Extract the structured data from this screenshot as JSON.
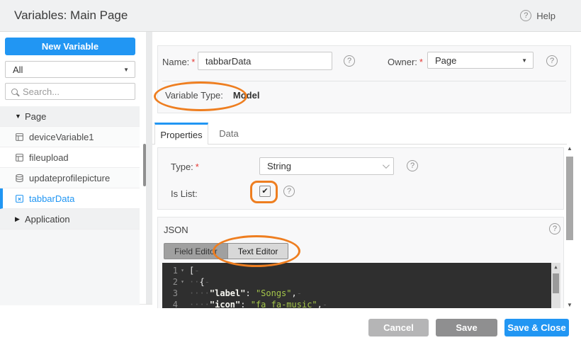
{
  "header": {
    "title": "Variables: Main Page",
    "help_label": "Help"
  },
  "icons": {
    "help_glyph": "?",
    "check_glyph": "✔",
    "caret_down": "▼",
    "caret_right": "▶",
    "select_caret": "▼",
    "fold_glyph": "▾",
    "arrow_up": "▲",
    "arrow_down": "▼"
  },
  "sidebar": {
    "new_variable_label": "New Variable",
    "filter": {
      "value": "All"
    },
    "search": {
      "placeholder": "Search..."
    },
    "tree": [
      {
        "type": "group",
        "label": "Page",
        "expanded": true
      },
      {
        "type": "item",
        "label": "deviceVariable1",
        "icon": "device-variable-icon",
        "selected": false
      },
      {
        "type": "item",
        "label": "fileupload",
        "icon": "device-variable-icon",
        "selected": false
      },
      {
        "type": "item",
        "label": "updateprofilepicture",
        "icon": "service-variable-icon",
        "selected": false
      },
      {
        "type": "item",
        "label": "tabbarData",
        "icon": "model-variable-icon",
        "selected": true
      },
      {
        "type": "group",
        "label": "Application",
        "expanded": false
      }
    ]
  },
  "form": {
    "name": {
      "label": "Name:",
      "required_mark": "*",
      "value": "tabbarData"
    },
    "owner": {
      "label": "Owner:",
      "required_mark": "*",
      "value": "Page"
    },
    "variable_type": {
      "label": "Variable Type:",
      "value": "Model"
    }
  },
  "tabs": {
    "items": [
      {
        "label": "Properties",
        "active": true
      },
      {
        "label": "Data",
        "active": false
      }
    ]
  },
  "properties": {
    "type": {
      "label": "Type:",
      "required_mark": "*",
      "value": "String"
    },
    "is_list": {
      "label": "Is List:",
      "checked": true
    }
  },
  "json_section": {
    "title": "JSON",
    "modes": [
      {
        "label": "Field Editor",
        "active": false
      },
      {
        "label": "Text Editor",
        "active": true
      }
    ],
    "code_lines": [
      {
        "num": "1",
        "fold": true,
        "tokens": [
          {
            "c": "punct",
            "t": "["
          }
        ]
      },
      {
        "num": "2",
        "fold": true,
        "tokens": [
          {
            "c": "ws",
            "t": "  "
          },
          {
            "c": "punct",
            "t": "{"
          }
        ]
      },
      {
        "num": "3",
        "fold": false,
        "tokens": [
          {
            "c": "ws",
            "t": "    "
          },
          {
            "c": "key",
            "t": "\"label\""
          },
          {
            "c": "punct",
            "t": ": "
          },
          {
            "c": "str",
            "t": "\"Songs\""
          },
          {
            "c": "punct",
            "t": ","
          }
        ]
      },
      {
        "num": "4",
        "fold": false,
        "tokens": [
          {
            "c": "ws",
            "t": "    "
          },
          {
            "c": "key",
            "t": "\"icon\""
          },
          {
            "c": "punct",
            "t": ": "
          },
          {
            "c": "str",
            "t": "\"fa fa-music\""
          },
          {
            "c": "punct",
            "t": ","
          }
        ]
      }
    ]
  },
  "footer": {
    "buttons": [
      {
        "label": "Cancel",
        "variant": "gray-light"
      },
      {
        "label": "Save",
        "variant": "gray-dark"
      },
      {
        "label": "Save & Close",
        "variant": "primary"
      }
    ]
  },
  "colors": {
    "accent_blue": "#2196f3",
    "annotation_orange": "#ee7e20",
    "editor_background": "#2f2f2f",
    "string_green": "#a5c64a",
    "required_red": "#e53935"
  }
}
